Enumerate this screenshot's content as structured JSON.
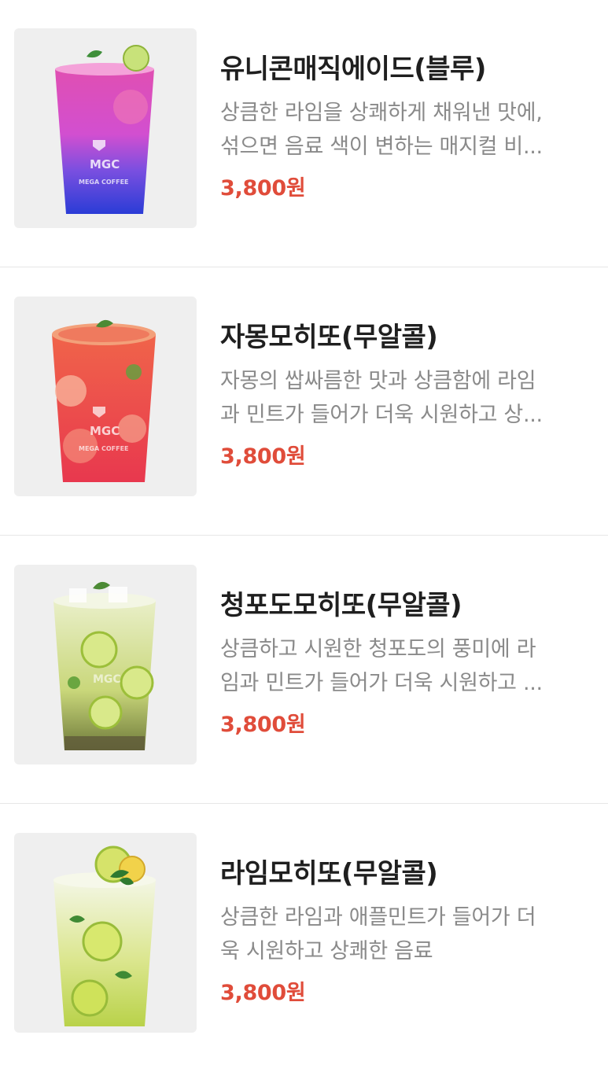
{
  "menu": {
    "items": [
      {
        "name": "유니콘매직에이드(블루)",
        "description_lines": [
          "상큼한 라임을 상쾌하게 채워낸 맛에,",
          "섞으면 음료 색이 변하는 매지컬 비..."
        ],
        "price": "3,800원",
        "image_icon": "blue-pink-ade-cup-icon",
        "cup_logo": "MGC",
        "cup_brand": "MEGA COFFEE",
        "colors": {
          "top": "#e04fb2",
          "bottom": "#2a3cd6"
        }
      },
      {
        "name": "자몽모히또(무알콜)",
        "description_lines": [
          "자몽의 쌉싸름한 맛과 상큼함에 라임",
          "과 민트가 들어가 더욱 시원하고 상..."
        ],
        "price": "3,800원",
        "image_icon": "grapefruit-mojito-cup-icon",
        "cup_logo": "MGC",
        "cup_brand": "MEGA COFFEE",
        "colors": {
          "top": "#f0644a",
          "bottom": "#e8384e"
        }
      },
      {
        "name": "청포도모히또(무알콜)",
        "description_lines": [
          "상큼하고 시원한 청포도의 풍미에 라",
          "임과 민트가 들어가 더욱 시원하고 ..."
        ],
        "price": "3,800원",
        "image_icon": "green-grape-mojito-cup-icon",
        "cup_logo": "MGC",
        "cup_brand": "",
        "colors": {
          "top": "#dfe9b0",
          "bottom": "#6f7a3a"
        }
      },
      {
        "name": "라임모히또(무알콜)",
        "description_lines": [
          "상큼한 라임과 애플민트가 들어가 더",
          "욱 시원하고 상쾌한 음료"
        ],
        "price": "3,800원",
        "image_icon": "lime-mojito-cup-icon",
        "cup_logo": "",
        "cup_brand": "",
        "colors": {
          "top": "#eef3d2",
          "bottom": "#b9d24a"
        }
      }
    ]
  },
  "theme": {
    "price_color": "#e04c3a",
    "name_color": "#1f1f1f",
    "desc_color": "#8a8a8a",
    "thumb_bg": "#efefef"
  }
}
